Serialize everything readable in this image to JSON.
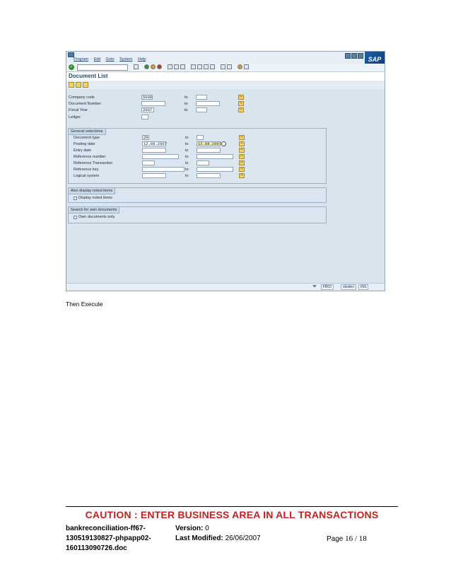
{
  "menu": [
    "Program",
    "Edit",
    "Goto",
    "System",
    "Help"
  ],
  "logo": "SAP",
  "screen_title": "Document List",
  "fields_top": [
    {
      "label": "Company code",
      "from": "5000",
      "to_label": "to",
      "to": ""
    },
    {
      "label": "Document Number",
      "from": "",
      "to_label": "to",
      "to": ""
    },
    {
      "label": "Fiscal Year",
      "from": "2007",
      "to_label": "to",
      "to": ""
    },
    {
      "label": "Ledger",
      "from": ""
    }
  ],
  "general": {
    "title": "General selections",
    "rows": [
      {
        "label": "Document type",
        "from": "ZR",
        "to_label": "to",
        "to": ""
      },
      {
        "label": "Posting date",
        "from": "12.08.2007",
        "to_label": "to",
        "to": "12.08.2007"
      },
      {
        "label": "Entry date",
        "from": "",
        "to_label": "to",
        "to": ""
      },
      {
        "label": "Reference number",
        "from": "",
        "to_label": "to",
        "to": ""
      },
      {
        "label": "Reference Transaction",
        "from": "",
        "to_label": "to",
        "to": ""
      },
      {
        "label": "Reference key",
        "from": "",
        "to_label": "to",
        "to": ""
      },
      {
        "label": "Logical system",
        "from": "",
        "to_label": "to",
        "to": ""
      }
    ]
  },
  "noted": {
    "title": "Also display noted items",
    "checkbox": "Display noted items"
  },
  "own": {
    "title": "Search for own documents",
    "checkbox": "Own documents only"
  },
  "status": {
    "tcode": "FB03",
    "server": "sbsdev",
    "mode": "INS"
  },
  "doc": {
    "then_text": "Then Execute",
    "caution": "CAUTION : ENTER BUSINESS AREA IN ALL TRANSACTIONS",
    "filename": "bankreconciliation-ff67-130519130827-phpapp02-160113090726.doc",
    "version_label": "Version:",
    "version": "0",
    "modified_label": "Last Modified:",
    "modified": "26/06/2007",
    "page_label": "Page",
    "page_current": "16",
    "page_sep": "/",
    "page_total": "18"
  }
}
